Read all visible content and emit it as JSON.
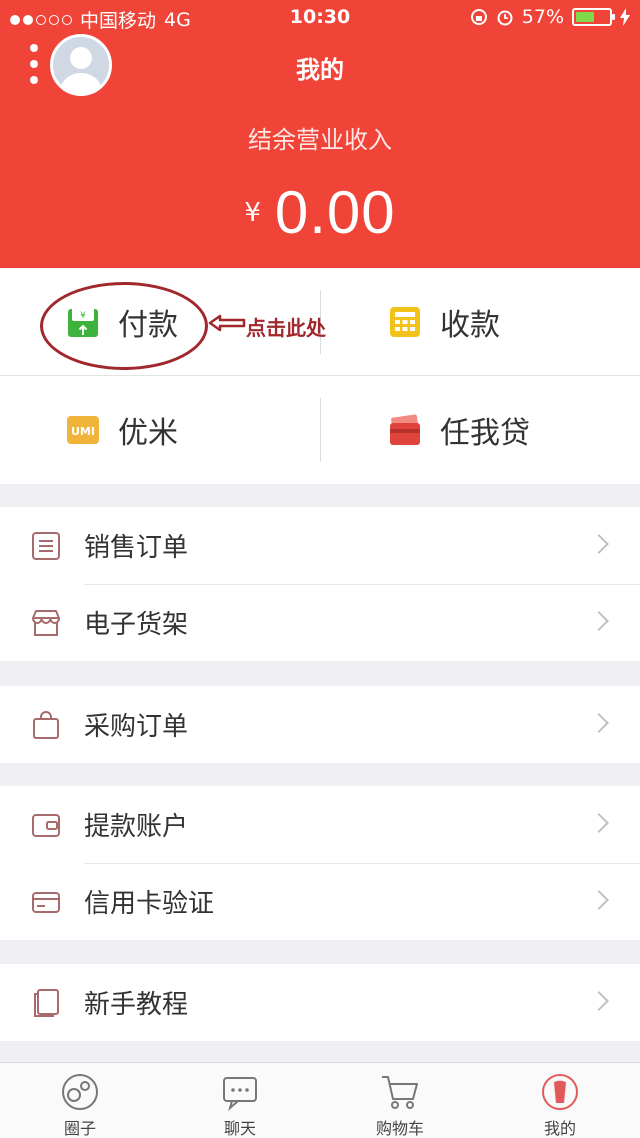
{
  "status_bar": {
    "carrier": "中国移动",
    "network": "4G",
    "time": "10:30",
    "battery": "57%",
    "battery_level": 0.57
  },
  "header": {
    "title": "我的",
    "income_label": "结余营业收入",
    "currency": "¥",
    "amount": "0.00",
    "bg_color": "#f04438"
  },
  "actions": [
    {
      "label": "付款",
      "icon": "wallet-pay-icon"
    },
    {
      "label": "收款",
      "icon": "calculator-icon"
    },
    {
      "label": "优米",
      "icon": "umi-icon"
    },
    {
      "label": "任我贷",
      "icon": "card-loan-icon"
    }
  ],
  "annotation": {
    "text": "点击此处"
  },
  "groups": [
    [
      {
        "label": "销售订单",
        "icon": "document-list-icon"
      },
      {
        "label": "电子货架",
        "icon": "shop-shelf-icon"
      }
    ],
    [
      {
        "label": "采购订单",
        "icon": "shopping-bag-icon"
      }
    ],
    [
      {
        "label": "提款账户",
        "icon": "wallet-icon"
      },
      {
        "label": "信用卡验证",
        "icon": "credit-card-icon"
      }
    ],
    [
      {
        "label": "新手教程",
        "icon": "tutorial-book-icon"
      }
    ]
  ],
  "tabbar": [
    {
      "label": "圈子",
      "icon": "circles-icon"
    },
    {
      "label": "聊天",
      "icon": "chat-icon"
    },
    {
      "label": "购物车",
      "icon": "cart-icon"
    },
    {
      "label": "我的",
      "icon": "profile-icon",
      "active": true
    }
  ]
}
